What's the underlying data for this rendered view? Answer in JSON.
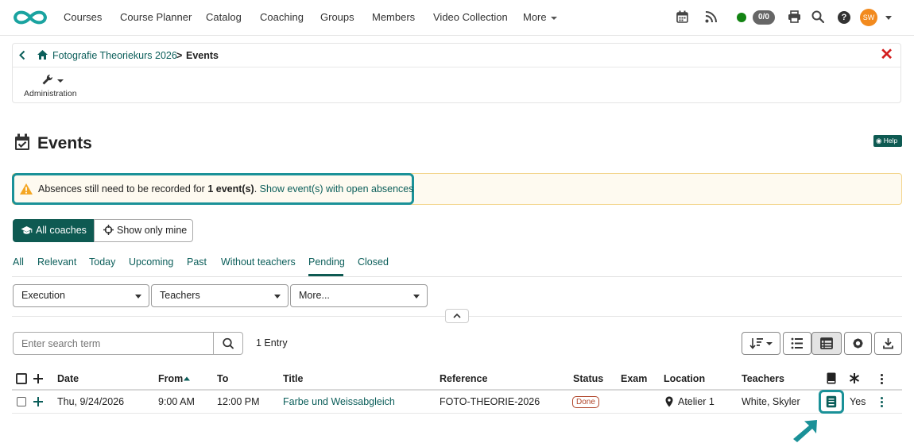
{
  "nav": {
    "items": [
      "Courses",
      "Course Planner",
      "Catalog",
      "Coaching",
      "Groups",
      "Members",
      "Video Collection"
    ],
    "more_label": "More",
    "score_badge": "0/0",
    "avatar_initials": "SW",
    "status_color": "#128312",
    "help_glyph": "?"
  },
  "breadcrumb": {
    "course_name": "Fotografie Theoriekurs 2026",
    "separator": ">",
    "current": "Events",
    "close_glyph": "✕"
  },
  "toolbar": {
    "administration_label": "Administration"
  },
  "page": {
    "title": "Events",
    "help_label": "Help"
  },
  "alert": {
    "text_prefix": "Absences still need to be recorded for ",
    "text_bold": "1 event(s)",
    "text_suffix": ". ",
    "link": "Show event(s) with open absences"
  },
  "coach_toggle": {
    "all_label": "All coaches",
    "mine_label": "Show only mine"
  },
  "tabs": {
    "items": [
      "All",
      "Relevant",
      "Today",
      "Upcoming",
      "Past",
      "Without teachers",
      "Pending",
      "Closed"
    ],
    "active": "Pending"
  },
  "filters": {
    "execution": "Execution",
    "teachers": "Teachers",
    "more": "More..."
  },
  "search": {
    "placeholder": "Enter search term",
    "entry_count": "1 Entry"
  },
  "table": {
    "columns": [
      "Date",
      "From",
      "To",
      "Title",
      "Reference",
      "Status",
      "Exam",
      "Location",
      "Teachers"
    ],
    "sorted_column": "From",
    "sort_direction": "ascending",
    "rows": [
      {
        "date": "Thu, 9/24/2026",
        "from": "9:00 AM",
        "to": "12:00 PM",
        "title": "Farbe und Weissabgleich",
        "reference": "FOTO-THEORIE-2026",
        "status": "Done",
        "exam": "",
        "location": "Atelier 1",
        "teachers": "White, Skyler",
        "extra": "Yes"
      }
    ]
  },
  "colors": {
    "brand": "#0e5a52",
    "link": "#0b5e5a",
    "highlight": "#1a9198",
    "alert_bg": "#fefaf0",
    "alert_border": "#f3d58c",
    "close_red": "#d31d1d",
    "status_done": "#b0452a",
    "avatar": "#f28a1e"
  }
}
